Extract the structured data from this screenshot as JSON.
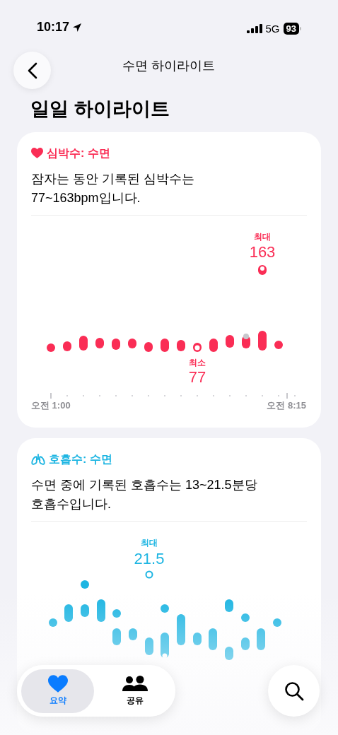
{
  "status_bar": {
    "time": "10:17",
    "network": "5G",
    "battery": "93"
  },
  "nav": {
    "title": "수면 하이라이트"
  },
  "section_title": "일일 하이라이트",
  "cards": [
    {
      "kind": "heart",
      "title": "심박수: 수면",
      "summary": "잠자는 동안 기록된 심박수는\n77~163bpm입니다.",
      "max_label": "최대",
      "max_value": "163",
      "min_label": "최소",
      "min_value": "77",
      "x_start": "오전 1:00",
      "x_end": "오전 8:15"
    },
    {
      "kind": "respiratory",
      "title": "호흡수: 수면",
      "summary": "수면 중에 기록된 호흡수는 13~21.5분당\n호흡수입니다.",
      "max_label": "최대",
      "max_value": "21.5"
    }
  ],
  "tabs": [
    {
      "label": "요약",
      "selected": true
    },
    {
      "label": "공유",
      "selected": false
    }
  ]
}
